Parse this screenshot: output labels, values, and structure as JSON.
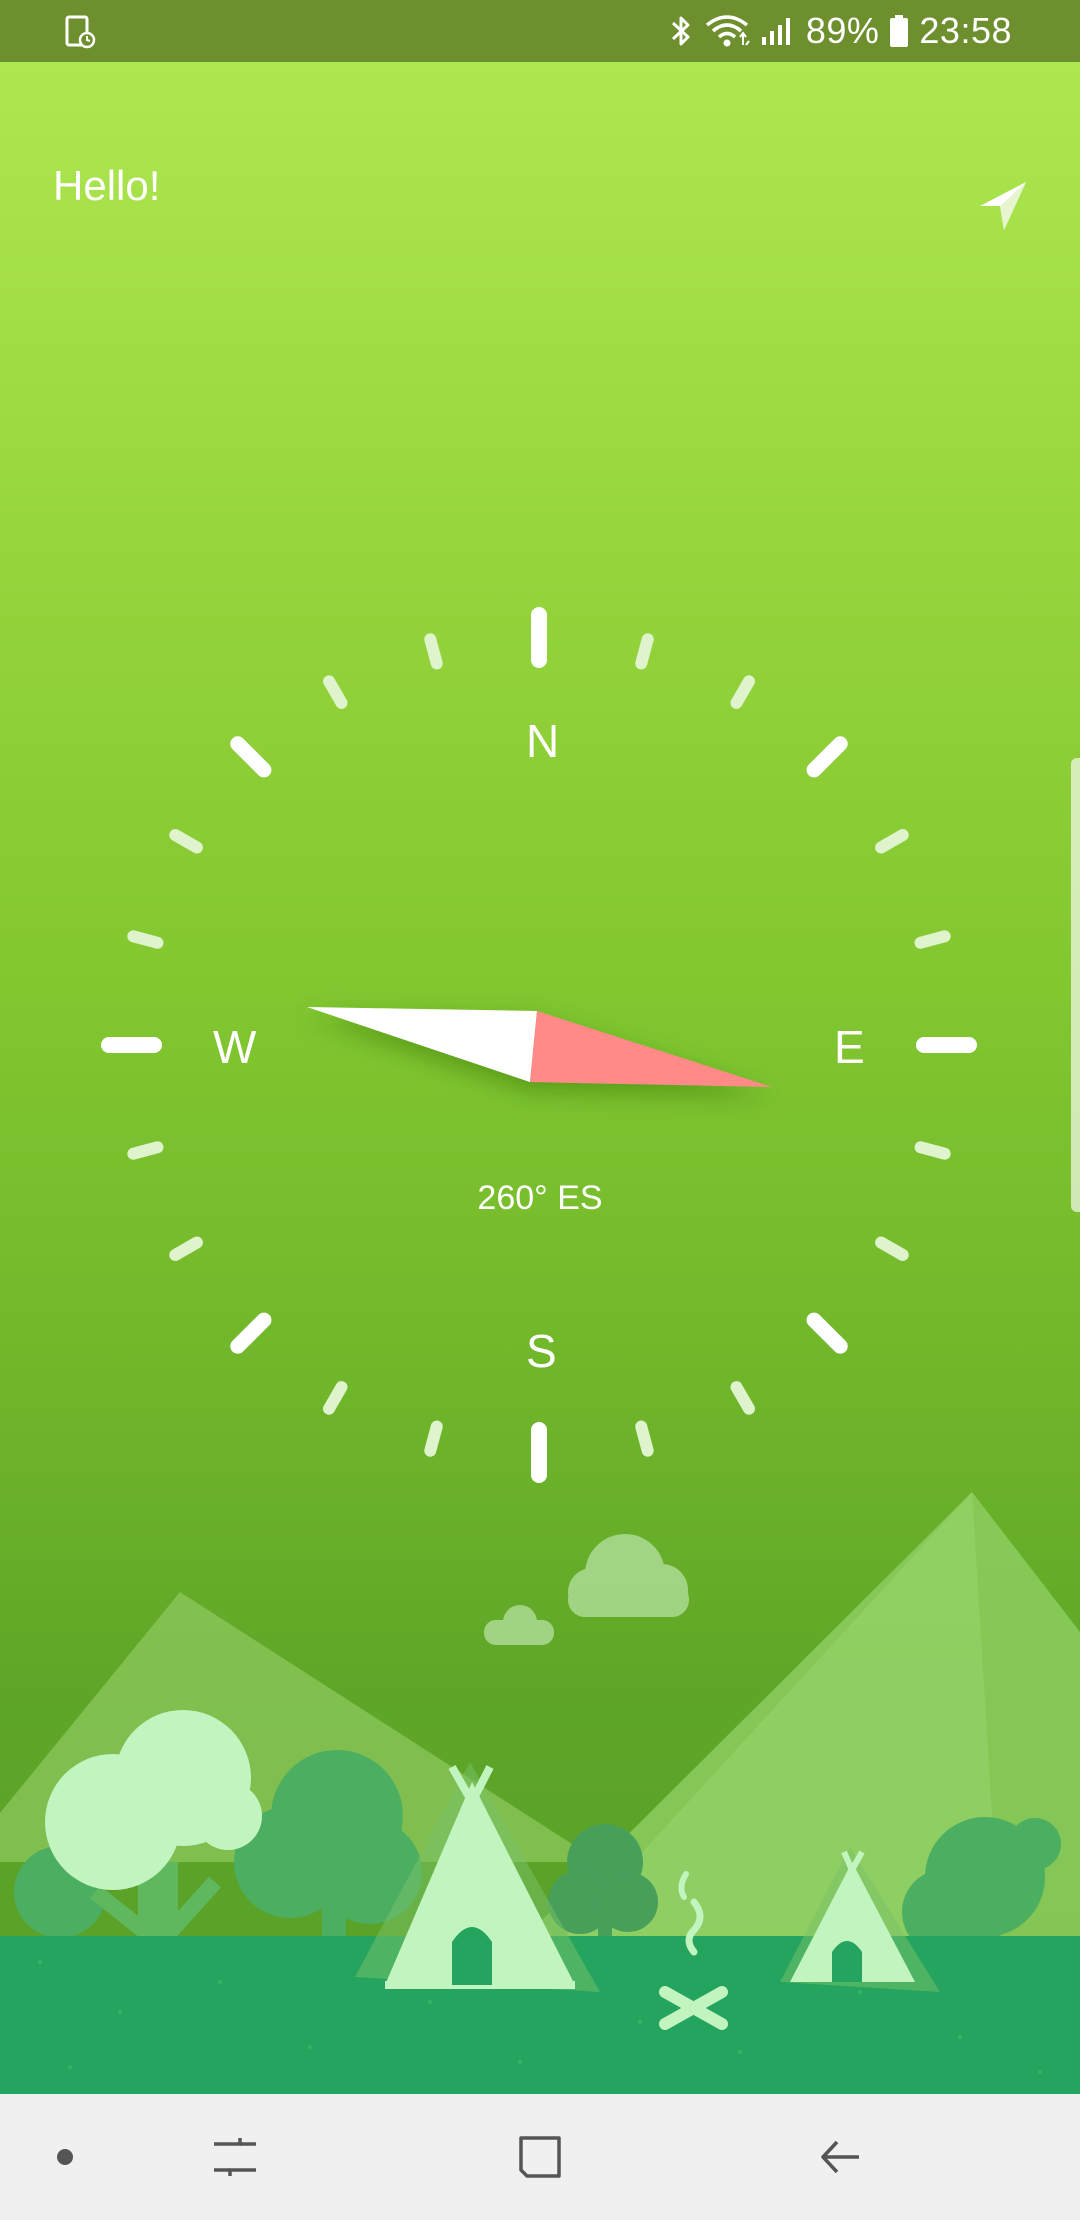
{
  "status_bar": {
    "left_icon": "screen-timer-icon",
    "battery_percent": "89%",
    "time": "23:58",
    "icons": [
      "bluetooth-icon",
      "wifi-icon",
      "signal-icon",
      "battery-icon"
    ]
  },
  "header": {
    "greeting": "Hello!",
    "action_icon": "navigation-arrow-icon"
  },
  "compass": {
    "north": "N",
    "east": "E",
    "south": "S",
    "west": "W",
    "heading": "260° ES",
    "needle_north_color": "#ffffff",
    "needle_south_color": "#ff8a87"
  },
  "colors": {
    "status_bar": "#6e8f2e",
    "background_top": "#aee74f",
    "background_bottom": "#56a027",
    "grass": "#24a45e",
    "accent_needle": "#ff8a87"
  },
  "nav_bar": {
    "buttons": [
      "dot-icon",
      "recents-icon",
      "home-icon",
      "back-icon"
    ]
  }
}
